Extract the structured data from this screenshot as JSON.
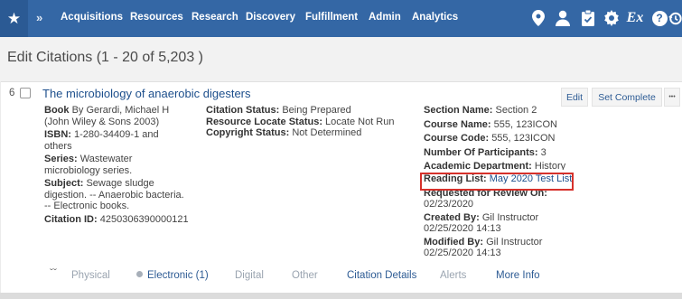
{
  "nav": {
    "menu": [
      "Acquisitions",
      "Resources",
      "Research",
      "Discovery",
      "Fulfillment",
      "Admin",
      "Analytics"
    ],
    "icons": [
      "star-icon",
      "location-pin-icon",
      "user-icon",
      "clipboard-icon",
      "gear-icon",
      "ex-libris-icon",
      "help-icon",
      "history-icon"
    ],
    "ex_label": "Ex",
    "help_label": "?"
  },
  "page": {
    "title": "Edit Citations (1 - 20 of 5,203 )"
  },
  "citation": {
    "row_number": "6",
    "title": "The microbiology of anaerobic digesters",
    "edit_label": "Edit",
    "set_complete_label": "Set Complete",
    "more_label": "•••",
    "col1": {
      "type": "Book",
      "author": "By Gerardi, Michael H",
      "publisher": "(John Wiley & Sons 2003)",
      "isbn_label": "ISBN:",
      "isbn": "1-280-34409-1 and others",
      "series_label": "Series:",
      "series": "Wastewater microbiology series.",
      "subject_label": "Subject:",
      "subject": "Sewage sludge digestion. -- Anaerobic bacteria. -- Electronic books.",
      "citation_id_label": "Citation ID:",
      "citation_id": "4250306390000121"
    },
    "col2": {
      "citation_status_label": "Citation Status:",
      "citation_status": "Being Prepared",
      "resource_locate_label": "Resource Locate Status:",
      "resource_locate": "Locate Not Run",
      "copyright_label": "Copyright Status:",
      "copyright": "Not Determined"
    },
    "col3": {
      "section_label": "Section Name:",
      "section": "Section 2",
      "course_name_label": "Course Name:",
      "course_name": "555, 123ICON",
      "course_code_label": "Course Code:",
      "course_code": "555, 123ICON",
      "participants_label": "Number Of Participants:",
      "participants": "3",
      "department_label": "Academic Department:",
      "department": "History",
      "reading_list_label": "Reading List:",
      "reading_list": "May 2020 Test List",
      "review_label": "Requested for Review On:",
      "review": "02/23/2020",
      "created_label": "Created By:",
      "created_by": "Gil Instructor",
      "created_on": "02/25/2020 14:13",
      "modified_label": "Modified By:",
      "modified_by": "Gil Instructor",
      "modified_on": "02/25/2020 14:13"
    },
    "tabs": {
      "physical": "Physical",
      "electronic": "Electronic (1)",
      "digital": "Digital",
      "other": "Other",
      "citation_details": "Citation Details",
      "alerts": "Alerts",
      "more_info": "More Info"
    }
  },
  "colors": {
    "nav_bg": "#3467a5",
    "link": "#1d4f8c",
    "highlight": "#d6312b"
  }
}
